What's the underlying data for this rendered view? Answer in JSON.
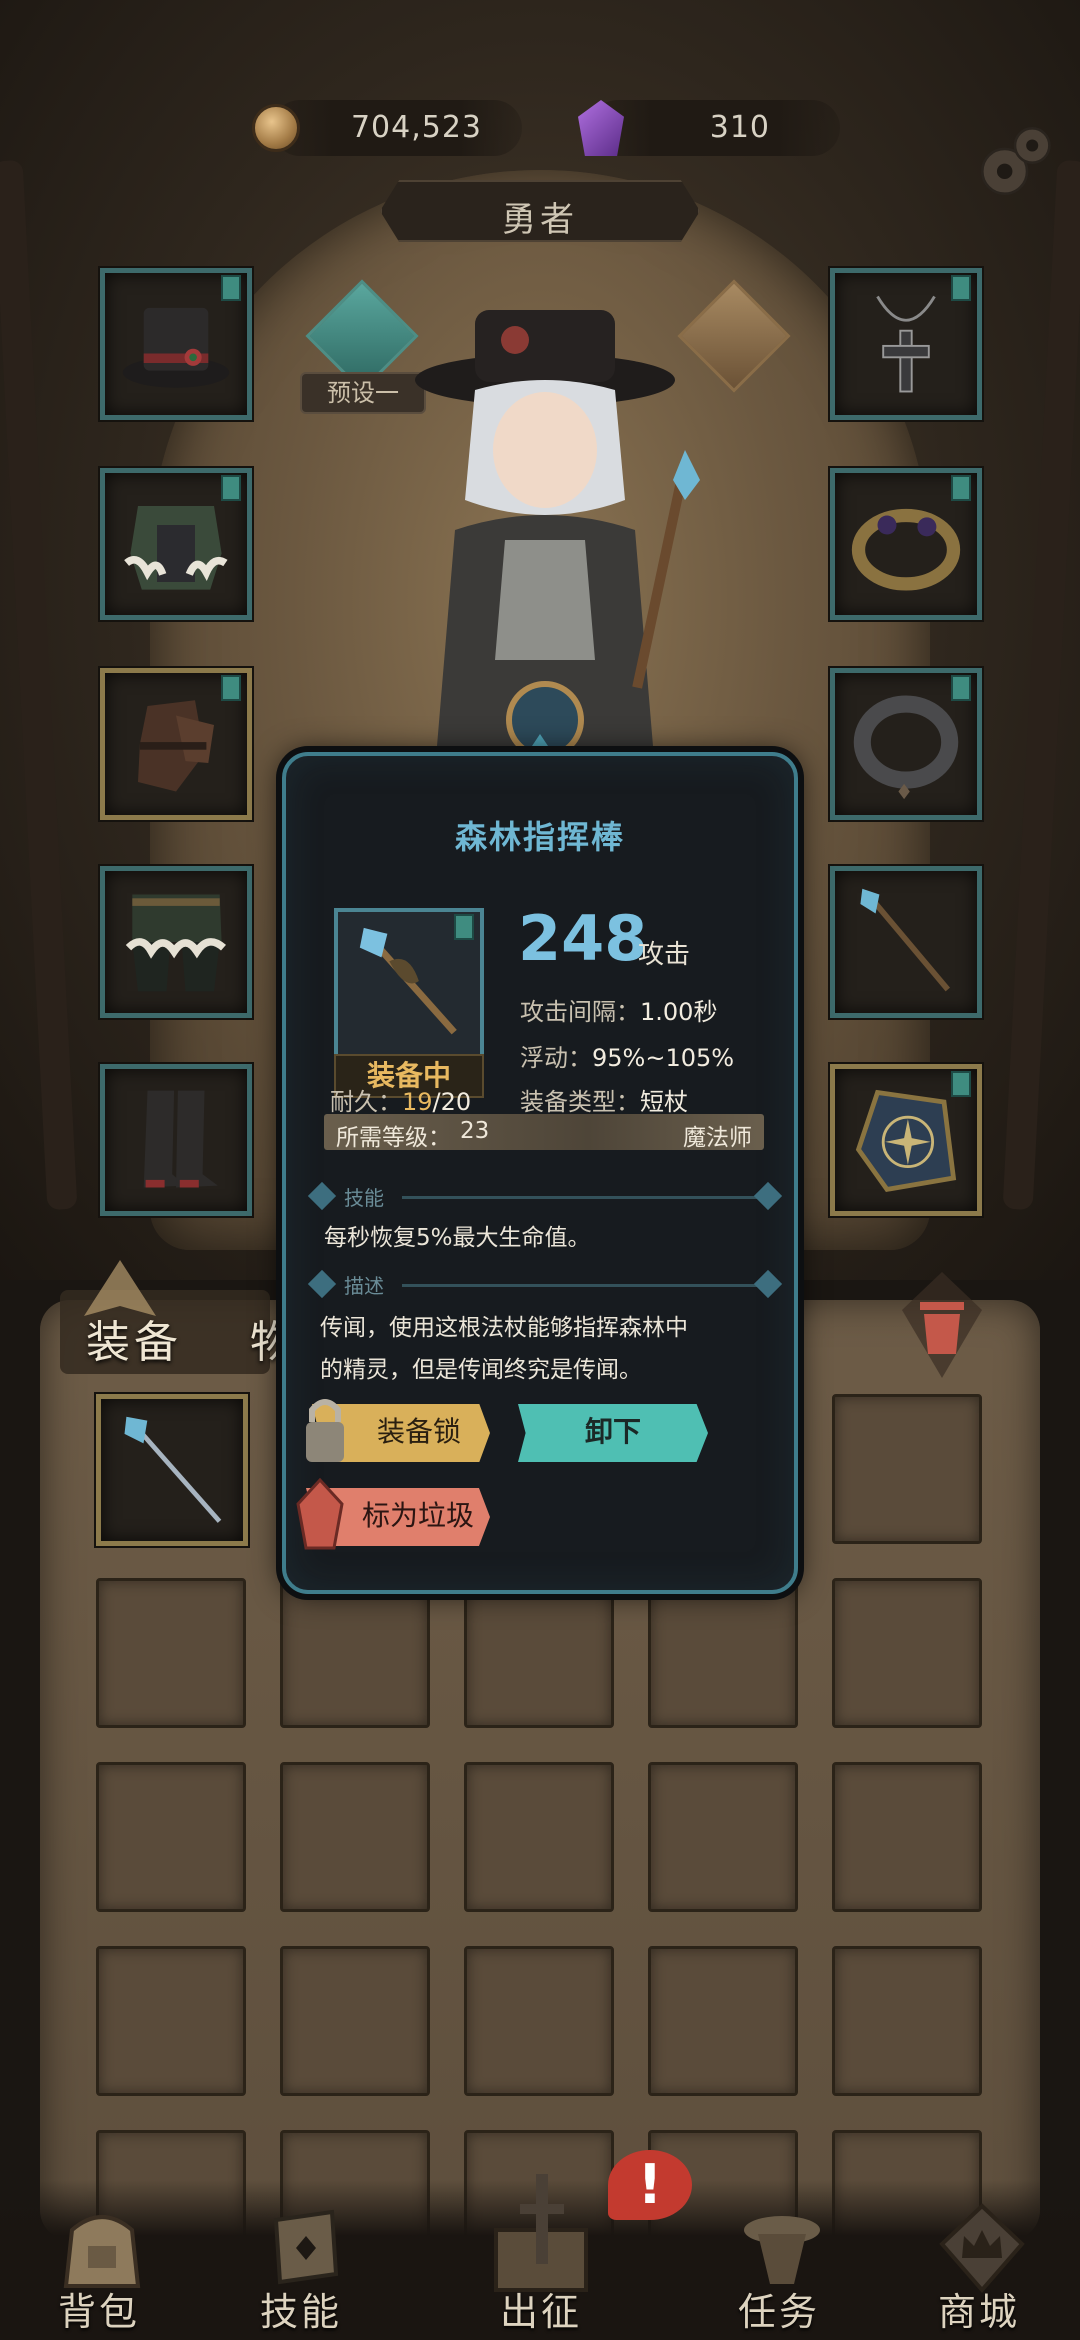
{
  "currency": {
    "gold": "704,523",
    "gems": "310"
  },
  "header": {
    "title": "勇者",
    "preset_label": "预设一"
  },
  "item_tooltip": {
    "name": "森林指挥棒",
    "equipped_label": "装备中",
    "attack_value": "248",
    "attack_label": "攻击",
    "attack_interval_label": "攻击间隔：",
    "attack_interval_value": "1.00秒",
    "variance_label": "浮动：",
    "variance_value": "95%~105%",
    "durability_label": "耐久：",
    "durability_current": "19",
    "durability_max": "/20",
    "equip_type_label": "装备类型：",
    "equip_type_value": "短杖",
    "required_level_label": "所需等级：",
    "required_level_value": "23",
    "class": "魔法师",
    "skill_header": "技能",
    "skill_text": "每秒恢复5%最大生命值。",
    "desc_header": "描述",
    "desc_line1": "传闻，使用这根法杖能够指挥森林中",
    "desc_line2": "的精灵，但是传闻终究是传闻。",
    "lock_button": "装备锁",
    "unequip_button": "卸下",
    "trash_button": "标为垃圾"
  },
  "bag": {
    "tab_equipment": "装备",
    "tab_items": "物"
  },
  "bottom_nav": [
    {
      "label": "背包",
      "icon": "backpack-icon"
    },
    {
      "label": "技能",
      "icon": "skill-book-icon"
    },
    {
      "label": "出征",
      "icon": "expedition-sword-icon"
    },
    {
      "label": "任务",
      "icon": "quest-scroll-icon"
    },
    {
      "label": "商城",
      "icon": "shop-crown-icon"
    }
  ],
  "alert_badge": "!",
  "colors": {
    "accent_teal": "#4fbfb3",
    "item_name": "#6fb7d3",
    "attack": "#7cc1e0",
    "equipped": "#e8b960",
    "lock_button": "#d9b05a",
    "trash_button": "#e07f6c"
  }
}
